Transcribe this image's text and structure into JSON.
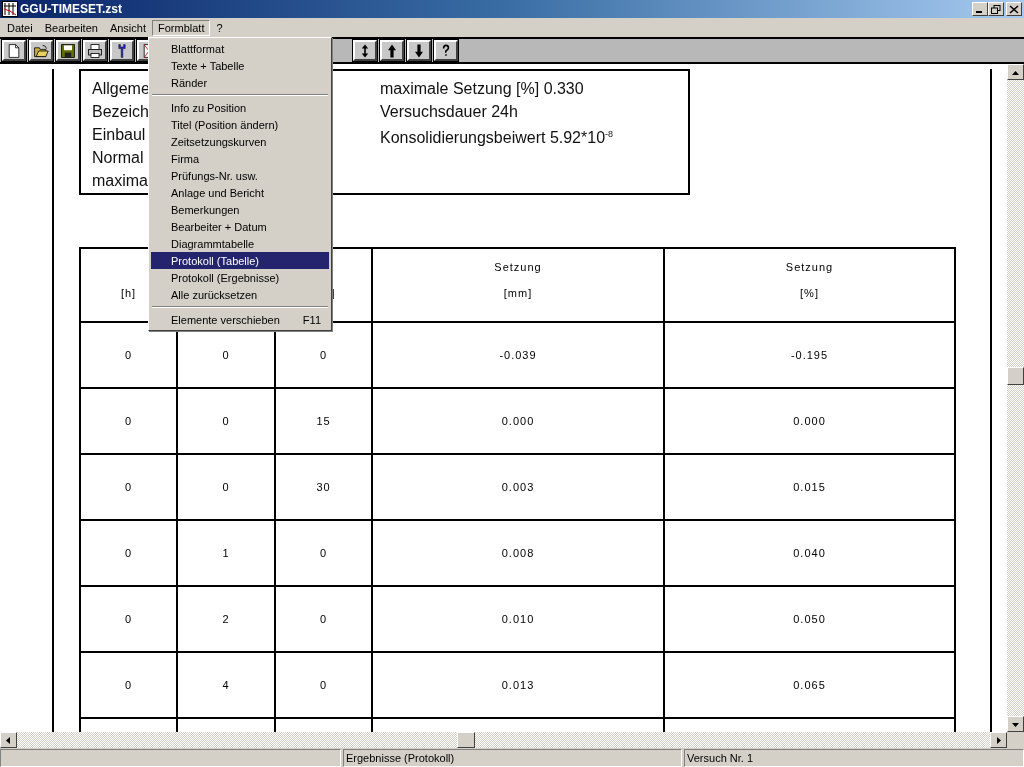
{
  "window": {
    "title": "GGU-TIMESET.zst"
  },
  "menu_bar": [
    {
      "label": "Datei",
      "selected": false
    },
    {
      "label": "Bearbeiten",
      "selected": false
    },
    {
      "label": "Ansicht",
      "selected": false
    },
    {
      "label": "Formblatt",
      "selected": true
    },
    {
      "label": "?",
      "selected": false
    }
  ],
  "dropdown_menu": [
    {
      "kind": "item",
      "label": "Blattformat",
      "selected": false
    },
    {
      "kind": "item",
      "label": "Texte + Tabelle",
      "selected": false
    },
    {
      "kind": "item",
      "label": "Ränder",
      "selected": false
    },
    {
      "kind": "separator"
    },
    {
      "kind": "item",
      "label": "Info zu Position",
      "selected": false
    },
    {
      "kind": "item",
      "label": "Titel (Position ändern)",
      "selected": false
    },
    {
      "kind": "item",
      "label": "Zeitsetzungskurven",
      "selected": false
    },
    {
      "kind": "item",
      "label": "Firma",
      "selected": false
    },
    {
      "kind": "item",
      "label": "Prüfungs-Nr. usw.",
      "selected": false
    },
    {
      "kind": "item",
      "label": "Anlage und Bericht",
      "selected": false
    },
    {
      "kind": "item",
      "label": "Bemerkungen",
      "selected": false
    },
    {
      "kind": "item",
      "label": "Bearbeiter + Datum",
      "selected": false
    },
    {
      "kind": "item",
      "label": "Diagrammtabelle",
      "selected": false
    },
    {
      "kind": "item",
      "label": "Protokoll (Tabelle)",
      "selected": true
    },
    {
      "kind": "item",
      "label": "Protokoll (Ergebnisse)",
      "selected": false
    },
    {
      "kind": "item",
      "label": "Alle zurücksetzen",
      "selected": false
    },
    {
      "kind": "separator"
    },
    {
      "kind": "item",
      "label": "Elemente verschieben",
      "shortcut": "F11",
      "selected": false
    }
  ],
  "info_box": {
    "left": [
      "Allgeme",
      "Bezeich",
      "Einbaul",
      "Normal",
      "maxima"
    ],
    "right": [
      "maximale Setzung [%] 0.330",
      "Versuchsdauer 24h",
      "Konsolidierungsbeiwert  5.92*10$^{-8}$"
    ]
  },
  "table": {
    "columns": [
      {
        "bottom": "[h]"
      },
      {},
      {
        "bottom": "]"
      },
      {
        "top": "Setzung",
        "bottom": "[mm]"
      },
      {
        "top": "Setzung",
        "bottom": "[%]"
      }
    ],
    "rows": [
      [
        "0",
        "0",
        "0",
        "-0.039",
        "-0.195"
      ],
      [
        "0",
        "0",
        "15",
        "0.000",
        "0.000"
      ],
      [
        "0",
        "0",
        "30",
        "0.003",
        "0.015"
      ],
      [
        "0",
        "1",
        "0",
        "0.008",
        "0.040"
      ],
      [
        "0",
        "2",
        "0",
        "0.010",
        "0.050"
      ],
      [
        "0",
        "4",
        "0",
        "0.013",
        "0.065"
      ]
    ]
  },
  "status_bar": [
    "Ergebnisse (Protokoll)",
    "Versuch Nr. 1"
  ]
}
